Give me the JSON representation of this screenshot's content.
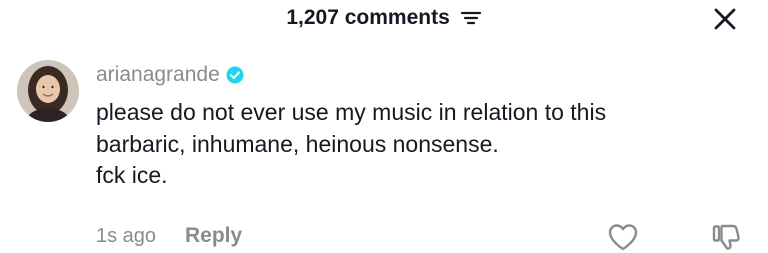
{
  "header": {
    "comments_count": "1,207 comments"
  },
  "comment": {
    "username": "arianagrande",
    "verified": true,
    "lines": [
      "please do not ever use my music in relation to this",
      "barbaric, inhumane, heinous nonsense.",
      "fck ice."
    ],
    "time": "1s ago",
    "reply_label": "Reply"
  },
  "icons": {
    "sort": "sort-icon",
    "close": "close-icon",
    "verified": "verified-badge-icon",
    "like": "heart-icon",
    "dislike": "thumbs-down-icon"
  },
  "colors": {
    "text_primary": "#161823",
    "text_secondary": "#8a8b91",
    "verified_blue": "#20d5ec"
  }
}
